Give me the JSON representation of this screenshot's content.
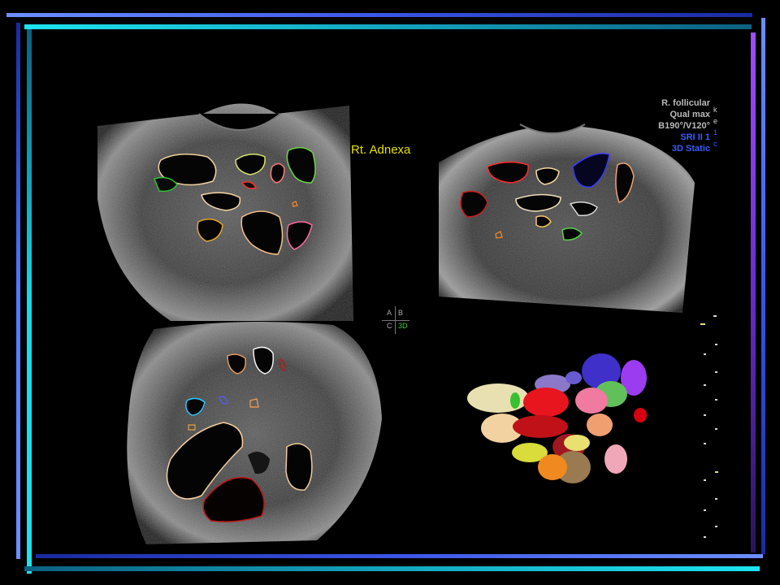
{
  "annotation": {
    "label": "Rt. Adnexa"
  },
  "settings_panel": {
    "lines": [
      "R. follicular",
      "Qual max",
      "B190°/V120°",
      "SRI II 1",
      "3D Static"
    ],
    "side_glyphs": [
      "k",
      "e",
      "1",
      "c"
    ]
  },
  "quadrant_indicator": {
    "a": "A",
    "b": "B",
    "c": "C",
    "d": "3D"
  },
  "colors": {
    "frame_blue": "#4f79ff",
    "frame_cyan": "#17d9ec",
    "frame_violet": "#8a3cff",
    "label_yellow": "#e7e000",
    "panel_blue": "#3a5cff"
  }
}
